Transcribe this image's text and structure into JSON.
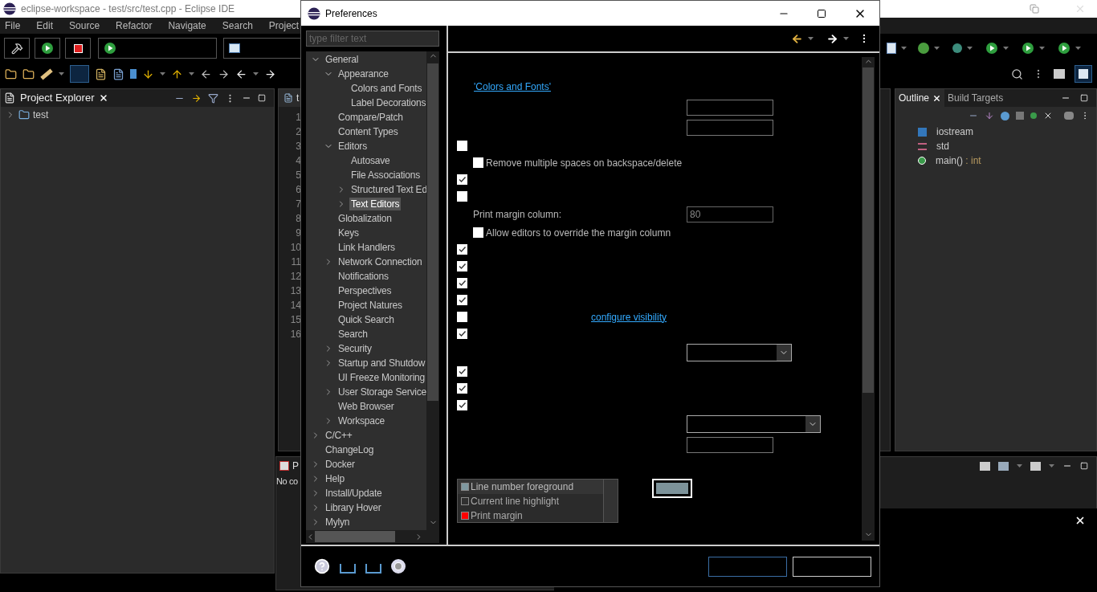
{
  "ide": {
    "title": "eclipse-workspace - test/src/test.cpp - Eclipse IDE",
    "menu": [
      "File",
      "Edit",
      "Source",
      "Refactor",
      "Navigate",
      "Search",
      "Project"
    ],
    "project_explorer": {
      "title": "Project Explorer",
      "items": [
        {
          "label": "test",
          "expanded": false
        }
      ]
    },
    "editor": {
      "tab": "t",
      "line_numbers": [
        "1",
        "2",
        "3",
        "4",
        "5",
        "6",
        "7",
        "8",
        "9",
        "10",
        "11",
        "12",
        "13",
        "14",
        "15",
        "16"
      ]
    },
    "outline": {
      "tabs": [
        {
          "label": "Outline",
          "selected": true
        },
        {
          "label": "Build Targets",
          "selected": false
        }
      ],
      "items": [
        {
          "label": "iostream",
          "kind": "include"
        },
        {
          "label": "std",
          "kind": "namespace"
        },
        {
          "label": "main()",
          "type": " : int",
          "kind": "function"
        }
      ]
    },
    "bottom_panel": {
      "tab": "P",
      "message": "No co"
    }
  },
  "dialog": {
    "title": "Preferences",
    "filter_placeholder": "type filter text",
    "tree": [
      {
        "label": "General",
        "expanded": true,
        "selected": false,
        "children": [
          {
            "label": "Appearance",
            "expanded": true,
            "selected": false,
            "children": [
              {
                "label": "Colors and Fonts",
                "selected": false
              },
              {
                "label": "Label Decorations",
                "selected": false
              }
            ]
          },
          {
            "label": "Compare/Patch",
            "selected": false
          },
          {
            "label": "Content Types",
            "selected": false
          },
          {
            "label": "Editors",
            "expanded": true,
            "selected": false,
            "children": [
              {
                "label": "Autosave",
                "selected": false
              },
              {
                "label": "File Associations",
                "selected": false
              },
              {
                "label": "Structured Text Ed",
                "expanded": false,
                "selected": false
              },
              {
                "label": "Text Editors",
                "expanded": false,
                "selected": true
              }
            ]
          },
          {
            "label": "Globalization",
            "selected": false
          },
          {
            "label": "Keys",
            "selected": false
          },
          {
            "label": "Link Handlers",
            "selected": false
          },
          {
            "label": "Network Connection",
            "expanded": false,
            "selected": false
          },
          {
            "label": "Notifications",
            "selected": false
          },
          {
            "label": "Perspectives",
            "selected": false
          },
          {
            "label": "Project Natures",
            "selected": false
          },
          {
            "label": "Quick Search",
            "selected": false
          },
          {
            "label": "Search",
            "selected": false
          },
          {
            "label": "Security",
            "expanded": false,
            "selected": false
          },
          {
            "label": "Startup and Shutdow",
            "expanded": false,
            "selected": false
          },
          {
            "label": "UI Freeze Monitoring",
            "selected": false
          },
          {
            "label": "User Storage Service",
            "expanded": false,
            "selected": false
          },
          {
            "label": "Web Browser",
            "selected": false
          },
          {
            "label": "Workspace",
            "expanded": false,
            "selected": false
          }
        ]
      },
      {
        "label": "C/C++",
        "expanded": false,
        "selected": false
      },
      {
        "label": "ChangeLog",
        "selected": false
      },
      {
        "label": "Docker",
        "expanded": false,
        "selected": false
      },
      {
        "label": "Help",
        "expanded": false,
        "selected": false
      },
      {
        "label": "Install/Update",
        "expanded": false,
        "selected": false
      },
      {
        "label": "Library Hover",
        "expanded": false,
        "selected": false
      },
      {
        "label": "Mylyn",
        "expanded": false,
        "selected": false
      }
    ],
    "rows": [
      {
        "kind": "link",
        "text": "'Colors and Fonts'"
      },
      {
        "kind": "field"
      },
      {
        "kind": "field"
      },
      {
        "kind": "check",
        "checked": false
      },
      {
        "kind": "check",
        "checked": false,
        "label": "Remove multiple spaces on backspace/delete",
        "indent": true
      },
      {
        "kind": "check",
        "checked": true
      },
      {
        "kind": "check",
        "checked": false
      },
      {
        "kind": "label_field",
        "label": "Print margin column:",
        "value": "80"
      },
      {
        "kind": "check",
        "checked": false,
        "label": "Allow editors to override the margin column",
        "indent": true
      },
      {
        "kind": "check",
        "checked": true
      },
      {
        "kind": "check",
        "checked": true
      },
      {
        "kind": "check",
        "checked": true
      },
      {
        "kind": "check",
        "checked": true
      },
      {
        "kind": "check",
        "checked": false,
        "link": "configure visibility"
      },
      {
        "kind": "check",
        "checked": true
      },
      {
        "kind": "combo"
      },
      {
        "kind": "check",
        "checked": true
      },
      {
        "kind": "check",
        "checked": true
      },
      {
        "kind": "check",
        "checked": true
      },
      {
        "kind": "combo"
      },
      {
        "kind": "field"
      }
    ],
    "colors": [
      {
        "label": "Line number foreground",
        "color": "#7f98a0",
        "selected": true
      },
      {
        "label": "Current line highlight",
        "color": "#303030",
        "selected": false
      },
      {
        "label": "Print margin",
        "color": "#ff0000",
        "selected": false
      }
    ],
    "color_button": {
      "color": "#7d939a"
    }
  }
}
